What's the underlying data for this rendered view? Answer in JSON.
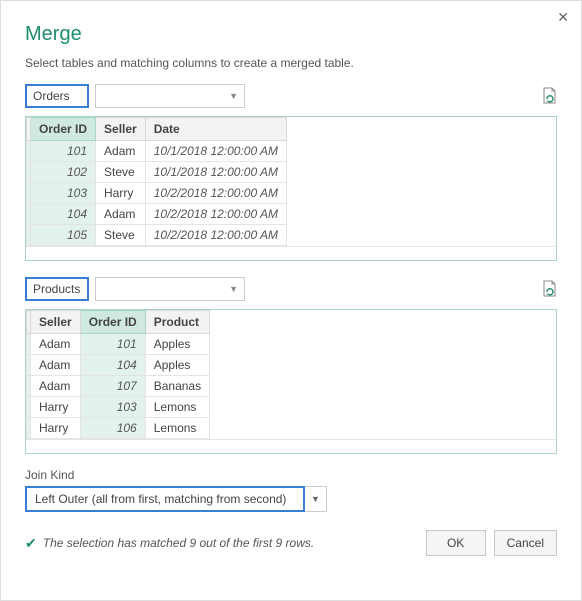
{
  "title": "Merge",
  "instruction": "Select tables and matching columns to create a merged table.",
  "table1": {
    "name": "Orders",
    "columns": [
      "Order ID",
      "Seller",
      "Date"
    ],
    "selectedColIndex": 0,
    "rows": [
      {
        "id": "101",
        "seller": "Adam",
        "date": "10/1/2018 12:00:00 AM"
      },
      {
        "id": "102",
        "seller": "Steve",
        "date": "10/1/2018 12:00:00 AM"
      },
      {
        "id": "103",
        "seller": "Harry",
        "date": "10/2/2018 12:00:00 AM"
      },
      {
        "id": "104",
        "seller": "Adam",
        "date": "10/2/2018 12:00:00 AM"
      },
      {
        "id": "105",
        "seller": "Steve",
        "date": "10/2/2018 12:00:00 AM"
      }
    ]
  },
  "table2": {
    "name": "Products",
    "columns": [
      "Seller",
      "Order ID",
      "Product"
    ],
    "selectedColIndex": 1,
    "rows": [
      {
        "seller": "Adam",
        "id": "101",
        "product": "Apples"
      },
      {
        "seller": "Adam",
        "id": "104",
        "product": "Apples"
      },
      {
        "seller": "Adam",
        "id": "107",
        "product": "Bananas"
      },
      {
        "seller": "Harry",
        "id": "103",
        "product": "Lemons"
      },
      {
        "seller": "Harry",
        "id": "106",
        "product": "Lemons"
      }
    ]
  },
  "joinKind": {
    "label": "Join Kind",
    "value": "Left Outer (all from first, matching from second)"
  },
  "status": "The selection has matched 9 out of the first 9 rows.",
  "buttons": {
    "ok": "OK",
    "cancel": "Cancel"
  }
}
